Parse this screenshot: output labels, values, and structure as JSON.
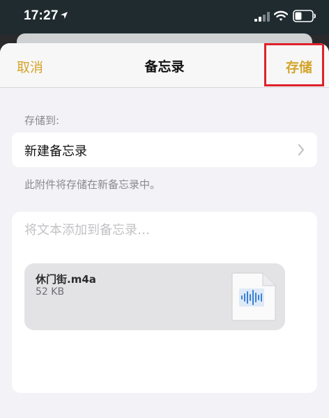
{
  "status_bar": {
    "time": "17:27",
    "icons": [
      "location-arrow-icon",
      "cellular-signal-icon",
      "wifi-icon",
      "battery-icon"
    ]
  },
  "nav": {
    "cancel_label": "取消",
    "title": "备忘录",
    "save_label": "存储"
  },
  "destination": {
    "section_label": "存储到:",
    "value": "新建备忘录",
    "footer": "此附件将存储在新备忘录中。"
  },
  "note": {
    "placeholder": "将文本添加到备忘录…",
    "attachment": {
      "name": "休门街.m4a",
      "size": "52 KB",
      "icon": "audio-waveform-file-icon"
    }
  },
  "colors": {
    "accent": "#d4a429",
    "highlight": "#e0202a",
    "background": "#f2f2f7"
  }
}
